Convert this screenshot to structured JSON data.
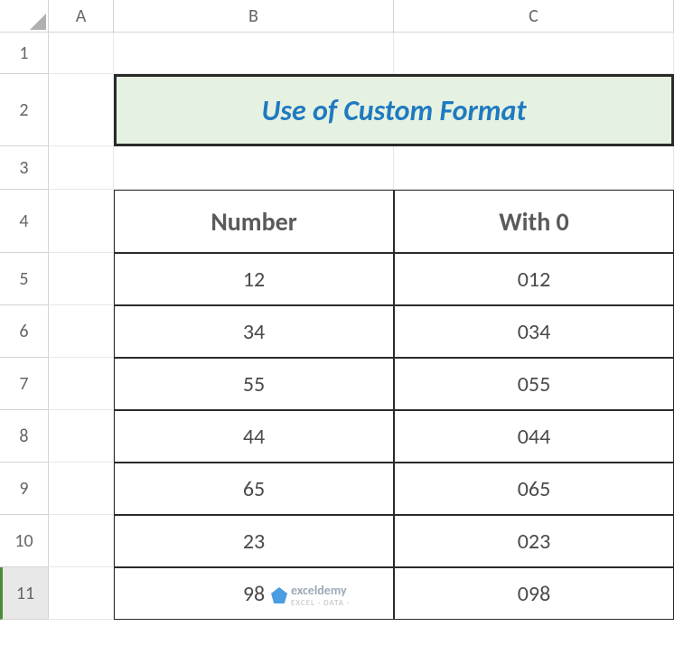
{
  "columns": [
    "A",
    "B",
    "C"
  ],
  "rows": [
    "1",
    "2",
    "3",
    "4",
    "5",
    "6",
    "7",
    "8",
    "9",
    "10",
    "11"
  ],
  "active_row": "11",
  "title": "Use of Custom Format",
  "table": {
    "headers": [
      "Number",
      "With 0"
    ],
    "data": [
      {
        "number": "12",
        "with0": "012"
      },
      {
        "number": "34",
        "with0": "034"
      },
      {
        "number": "55",
        "with0": "055"
      },
      {
        "number": "44",
        "with0": "044"
      },
      {
        "number": "65",
        "with0": "065"
      },
      {
        "number": "23",
        "with0": "023"
      },
      {
        "number": "98",
        "with0": "098"
      }
    ]
  },
  "watermark": {
    "brand": "exceldemy",
    "sub": "EXCEL · DATA ·"
  },
  "chart_data": {
    "type": "table",
    "title": "Use of Custom Format",
    "columns": [
      "Number",
      "With 0"
    ],
    "rows": [
      [
        12,
        "012"
      ],
      [
        34,
        "034"
      ],
      [
        55,
        "055"
      ],
      [
        44,
        "044"
      ],
      [
        65,
        "065"
      ],
      [
        23,
        "023"
      ],
      [
        98,
        "098"
      ]
    ]
  }
}
